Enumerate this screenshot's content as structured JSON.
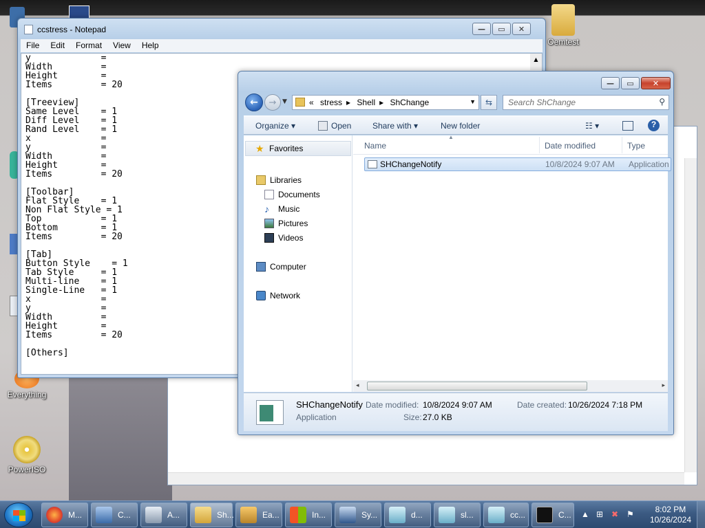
{
  "desktop": {
    "icons": [
      {
        "label": "Oemtest"
      },
      {
        "label": "Everything"
      },
      {
        "label": "PowerISO"
      }
    ]
  },
  "notepad": {
    "title": "ccstress - Notepad",
    "menu": [
      "File",
      "Edit",
      "Format",
      "View",
      "Help"
    ],
    "content": "y             =\nWidth         =\nHeight        =\nItems         = 20\n\n[Treeview]\nSame Level    = 1\nDiff Level    = 1\nRand Level    = 1\nx             =\ny             =\nWidth         =\nHeight        =\nItems         = 20\n\n[Toolbar]\nFlat Style    = 1\nNon Flat Style = 1\nTop           = 1\nBottom        = 1\nItems         = 20\n\n[Tab]\nButton Style    = 1\nTab Style     = 1\nMulti-line    = 1\nSingle-Line   = 1\nx             =\ny             =\nWidth         =\nHeight        =\nItems         = 20\n\n[Others]"
  },
  "explorer": {
    "breadcrumb": [
      "«",
      "stress",
      "Shell",
      "ShChange"
    ],
    "search_placeholder": "Search ShChange",
    "commands": {
      "organize": "Organize",
      "open": "Open",
      "share_with": "Share with",
      "new_folder": "New folder"
    },
    "nav": {
      "favorites": "Favorites",
      "libraries": "Libraries",
      "documents": "Documents",
      "music": "Music",
      "pictures": "Pictures",
      "videos": "Videos",
      "computer": "Computer",
      "network": "Network"
    },
    "columns": {
      "name": "Name",
      "date_modified": "Date modified",
      "type": "Type"
    },
    "files": [
      {
        "name": "SHChangeNotify",
        "date_modified": "10/8/2024 9:07 AM",
        "type": "Application"
      }
    ],
    "details": {
      "name": "SHChangeNotify",
      "type": "Application",
      "date_modified_label": "Date modified:",
      "date_modified": "10/8/2024 9:07 AM",
      "date_created_label": "Date created:",
      "date_created": "10/26/2024 7:18 PM",
      "size_label": "Size:",
      "size": "27.0 KB"
    }
  },
  "taskbar": {
    "buttons": [
      "M...",
      "C...",
      "A...",
      "Sh...",
      "Ea...",
      "In...",
      "Sy...",
      "d...",
      "sl...",
      "cc...",
      "C..."
    ],
    "time": "8:02 PM",
    "date": "10/26/2024"
  }
}
